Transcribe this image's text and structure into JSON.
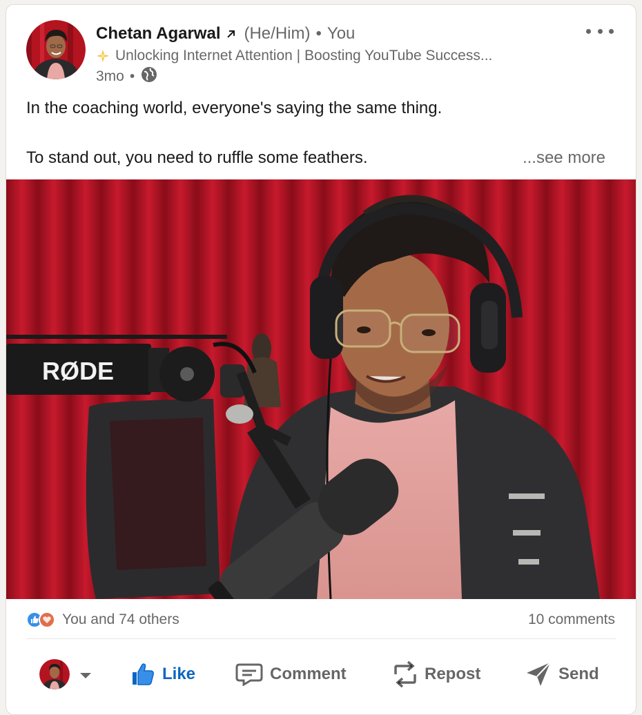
{
  "author": {
    "name": "Chetan Agarwal",
    "pronouns": "(He/Him)",
    "separator": "•",
    "relation": "You",
    "headline": "Unlocking Internet Attention | Boosting YouTube Success...",
    "time": "3mo",
    "time_separator": "•"
  },
  "post": {
    "line1": "In the coaching world, everyone's saying the same thing.",
    "line2": "To stand out, you need to ruffle some feathers.",
    "see_more": "...see more",
    "image_text": "RØDE"
  },
  "social": {
    "reactions_text": "You and 74 others",
    "comments_text": "10 comments"
  },
  "actions": {
    "like": "Like",
    "comment": "Comment",
    "repost": "Repost",
    "send": "Send"
  },
  "colors": {
    "like_blue": "#0a66c2",
    "curtain_red": "#c0182a",
    "love": "#df704d"
  },
  "icons": {
    "arrow": "external-link-arrow-icon",
    "sparkle": "sparkle-icon",
    "globe": "globe-icon",
    "more": "more-options-icon",
    "like": "thumbs-up-icon",
    "comment": "comment-bubble-icon",
    "repost": "repost-icon",
    "send": "send-icon"
  }
}
